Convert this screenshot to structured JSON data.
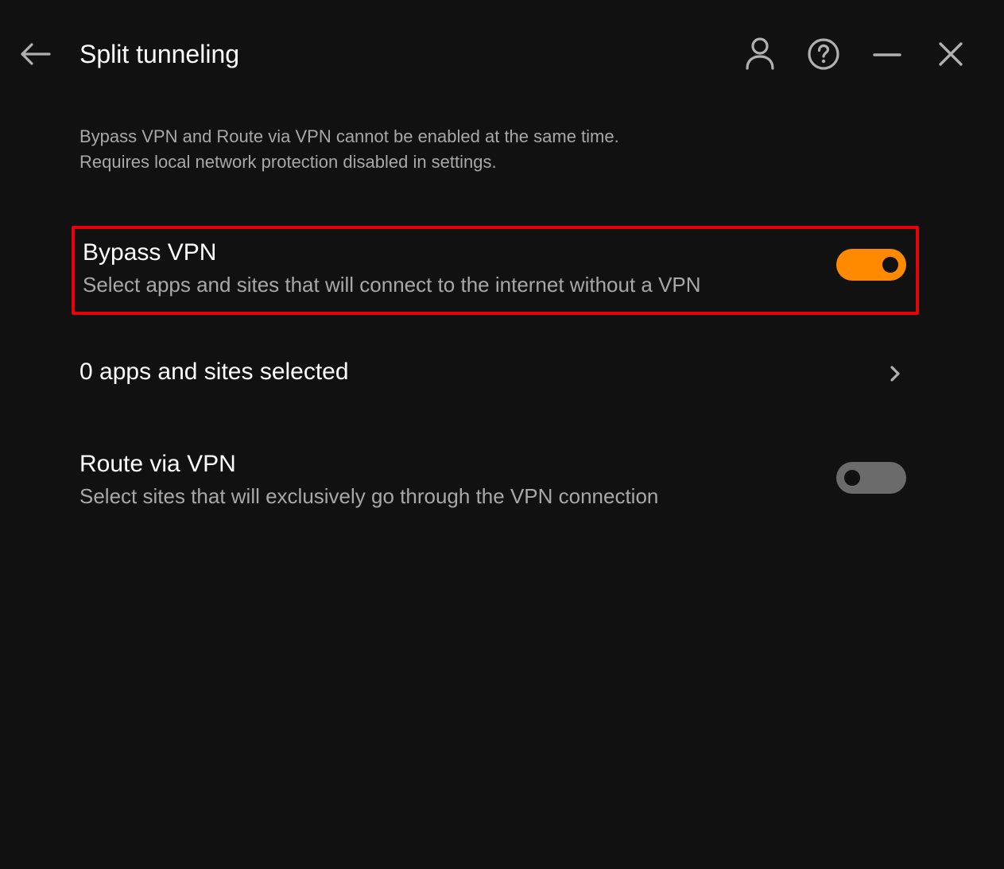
{
  "header": {
    "title": "Split tunneling",
    "back_icon": "arrow-left-icon",
    "account_icon": "person-icon",
    "help_icon": "question-circle-icon",
    "minimize_icon": "minimize-icon",
    "close_icon": "close-icon"
  },
  "info": {
    "line1": "Bypass VPN and Route via VPN cannot be enabled at the same time.",
    "line2": "Requires local network protection disabled in settings."
  },
  "bypass": {
    "title": "Bypass VPN",
    "subtitle": "Select apps and sites that will connect to the internet without a VPN",
    "enabled": true
  },
  "apps_selected": {
    "label": "0 apps and sites selected",
    "icon": "chevron-right-icon"
  },
  "route": {
    "title": "Route via VPN",
    "subtitle": "Select sites that will exclusively go through the VPN connection",
    "enabled": false
  },
  "colors": {
    "background": "#111111",
    "toggle_on": "#ff8a00",
    "toggle_off": "#6b6b6b",
    "highlight_border": "#e8000b",
    "secondary_text": "#a8a8a8"
  }
}
